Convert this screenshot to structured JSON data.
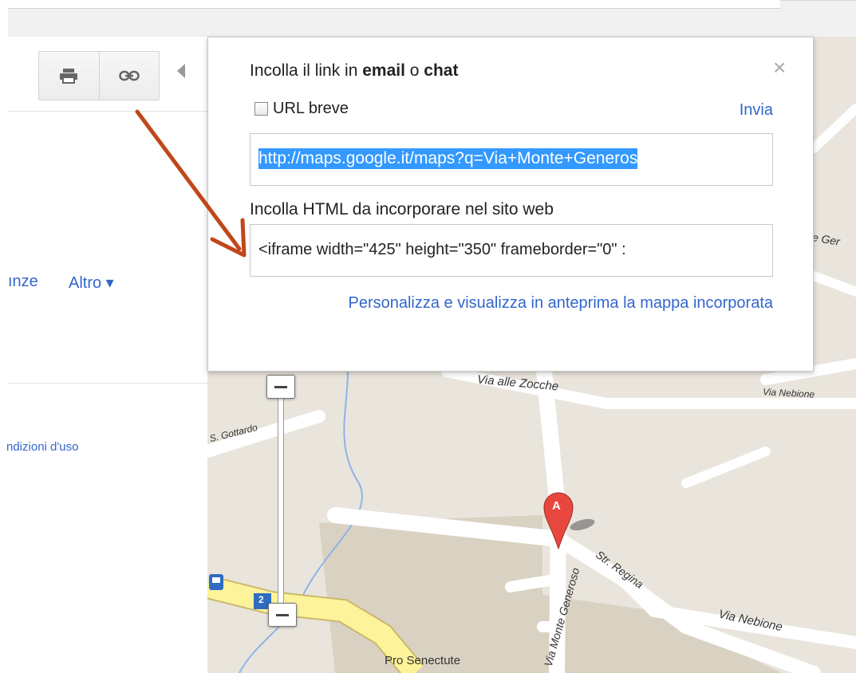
{
  "toolbar": {
    "print_icon": "print-icon",
    "link_icon": "link-icon"
  },
  "left_panel": {
    "partial_nav_text": "ınze",
    "more_label": "Altro ▾",
    "terms_partial": "ndizioni d'uso"
  },
  "share_popup": {
    "title_prefix": "Incolla il link in ",
    "title_email": "email",
    "title_mid": " o ",
    "title_chat": "chat",
    "short_url_label": "URL breve",
    "send_label": "Invia",
    "link_value": "http://maps.google.it/maps?q=Via+Monte+Generos",
    "embed_label": "Incolla HTML da incorporare nel sito web",
    "embed_value": "<iframe width=\"425\" height=\"350\" frameborder=\"0\" :",
    "customize_link": "Personalizza e visualizza in anteprima la mappa incorporata",
    "close_symbol": "×"
  },
  "map": {
    "streets": [
      "Via alle Zocche",
      "Via Nebione",
      "S. Gottardo",
      "Str. Regina",
      "Via Nebione",
      "Via Monte Generoso",
      "Pro Senectute",
      "e Ger"
    ],
    "marker_label": "A",
    "route_number": "2",
    "bus_icon": "bus-stop-icon"
  },
  "colors": {
    "link": "#3366cc",
    "selection": "#3399ff",
    "arrow": "#c0471a",
    "map_bg": "#e9e5dc",
    "marker": "#e8473f"
  }
}
